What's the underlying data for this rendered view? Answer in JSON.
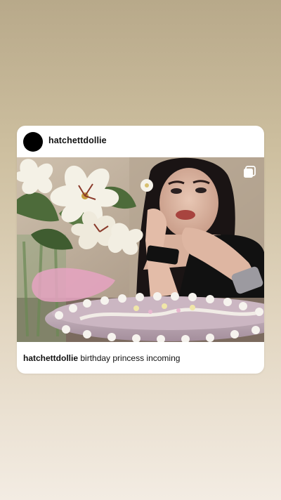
{
  "post": {
    "username": "hatchettdollie",
    "caption_username": "hatchettdollie",
    "caption_text": "birthday princess incoming",
    "photo_icon": "multiple-photos-icon"
  },
  "colors": {
    "background_top": "#b8a98a",
    "background_bottom": "#f3ece3",
    "card": "#ffffff",
    "avatar": "#000000"
  }
}
